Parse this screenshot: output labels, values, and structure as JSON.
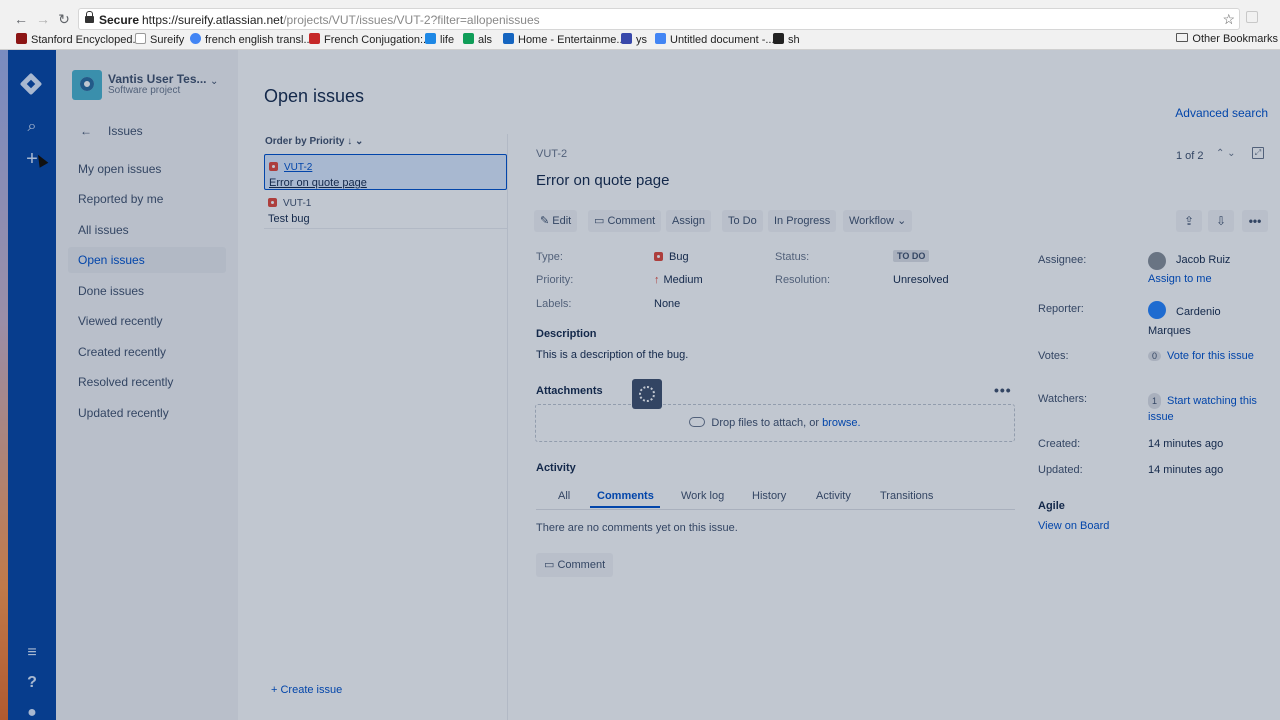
{
  "browser": {
    "secure_label": "Secure",
    "url_host": "https://sureify.atlassian.net",
    "url_path": "/projects/VUT/issues/VUT-2?filter=allopenissues",
    "bookmarks": [
      {
        "label": "Stanford Encycloped...",
        "color": "#8c1515"
      },
      {
        "label": "Sureify",
        "color": "#f4f4f4"
      },
      {
        "label": "french english transl...",
        "color": "#4285f4"
      },
      {
        "label": "French Conjugation:...",
        "color": "#c62828"
      },
      {
        "label": "life",
        "color": "#1e88e5"
      },
      {
        "label": "als",
        "color": "#0f9d58"
      },
      {
        "label": "Home - Entertainme...",
        "color": "#1565c0"
      },
      {
        "label": "ys",
        "color": "#3949ab"
      },
      {
        "label": "Untitled document -...",
        "color": "#4285f4"
      },
      {
        "label": "sh",
        "color": "#222222"
      }
    ],
    "other_bookmarks": "Other Bookmarks"
  },
  "project": {
    "name": "Vantis User Tes...",
    "type": "Software project",
    "section": "Issues"
  },
  "sidebar": {
    "items": [
      {
        "label": "My open issues"
      },
      {
        "label": "Reported by me"
      },
      {
        "label": "All issues"
      },
      {
        "label": "Open issues",
        "active": true
      },
      {
        "label": "Done issues"
      },
      {
        "label": "Viewed recently"
      },
      {
        "label": "Created recently"
      },
      {
        "label": "Resolved recently"
      },
      {
        "label": "Updated recently"
      }
    ]
  },
  "main": {
    "title": "Open issues",
    "advanced_search": "Advanced search",
    "order_by": "Order by Priority",
    "issues": [
      {
        "key": "VUT-2",
        "summary": "Error on quote page"
      },
      {
        "key": "VUT-1",
        "summary": "Test bug"
      }
    ],
    "create_issue": "+ Create issue"
  },
  "detail": {
    "key": "VUT-2",
    "title": "Error on quote page",
    "pager": "1 of 2",
    "toolbar": {
      "edit": "Edit",
      "comment": "Comment",
      "assign": "Assign",
      "todo": "To Do",
      "in_progress": "In Progress",
      "workflow": "Workflow"
    },
    "fields": {
      "type_label": "Type:",
      "type_value": "Bug",
      "priority_label": "Priority:",
      "priority_value": "Medium",
      "labels_label": "Labels:",
      "labels_value": "None",
      "status_label": "Status:",
      "status_value": "TO DO",
      "resolution_label": "Resolution:",
      "resolution_value": "Unresolved"
    },
    "description_heading": "Description",
    "description": "This is a description of the bug.",
    "attachments_heading": "Attachments",
    "drop_text": "Drop files to attach, or",
    "browse": "browse.",
    "activity_heading": "Activity",
    "activity_tabs": [
      "All",
      "Comments",
      "Work log",
      "History",
      "Activity",
      "Transitions"
    ],
    "no_comments": "There are no comments yet on this issue.",
    "comment_button": "Comment"
  },
  "people": {
    "assignee_label": "Assignee:",
    "assignee": "Jacob Ruiz",
    "assign_to_me": "Assign to me",
    "reporter_label": "Reporter:",
    "reporter": "Cardenio Marques",
    "votes_label": "Votes:",
    "votes_count": "0",
    "vote_link": "Vote for this issue",
    "watchers_label": "Watchers:",
    "watchers_count": "1",
    "watch_link": "Start watching this issue",
    "created_label": "Created:",
    "created": "14 minutes ago",
    "updated_label": "Updated:",
    "updated": "14 minutes ago",
    "agile_heading": "Agile",
    "view_on_board": "View on Board"
  }
}
